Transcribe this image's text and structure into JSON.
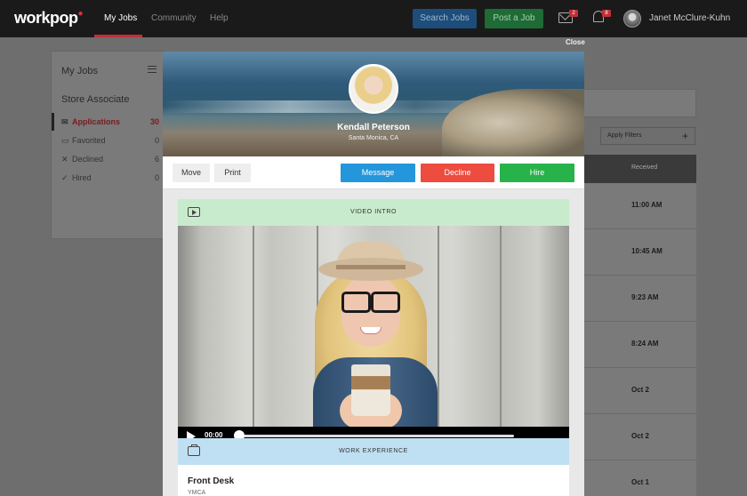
{
  "nav": {
    "logo": "workpop",
    "links": [
      "My Jobs",
      "Community",
      "Help"
    ],
    "search_jobs": "Search Jobs",
    "post_job": "Post a Job",
    "mail_badge": "2",
    "notif_badge": "8",
    "user_name": "Janet McClure-Kuhn",
    "close": "Close"
  },
  "sidebar": {
    "title": "My Jobs",
    "subtitle": "Store Associate",
    "items": [
      {
        "label": "Applications",
        "count": "30",
        "icon": "inbox-icon"
      },
      {
        "label": "Favorited",
        "count": "0",
        "icon": "folder-icon"
      },
      {
        "label": "Declined",
        "count": "6",
        "icon": "x-icon"
      },
      {
        "label": "Hired",
        "count": "0",
        "icon": "check-icon"
      }
    ]
  },
  "table": {
    "apply_filters": "Apply Filters",
    "received_header": "Received",
    "rows": [
      "11:00 AM",
      "10:45 AM",
      "9:23 AM",
      "8:24 AM",
      "Oct 2",
      "Oct 2",
      "Oct 1"
    ]
  },
  "modal": {
    "candidate_name": "Kendall Peterson",
    "candidate_location": "Santa Monica, CA",
    "actions": {
      "move": "Move",
      "print": "Print",
      "message": "Message",
      "decline": "Decline",
      "hire": "Hire"
    },
    "video_intro": {
      "header": "VIDEO INTRO",
      "time": "00:00",
      "progress": 0
    },
    "work_experience": {
      "header": "WORK EXPERIENCE",
      "job_title": "Front Desk",
      "job_sub": "YMCA"
    }
  },
  "colors": {
    "message": "#2496db",
    "decline": "#ed4c3f",
    "hire": "#27b24a",
    "accent": "#c0303a"
  }
}
